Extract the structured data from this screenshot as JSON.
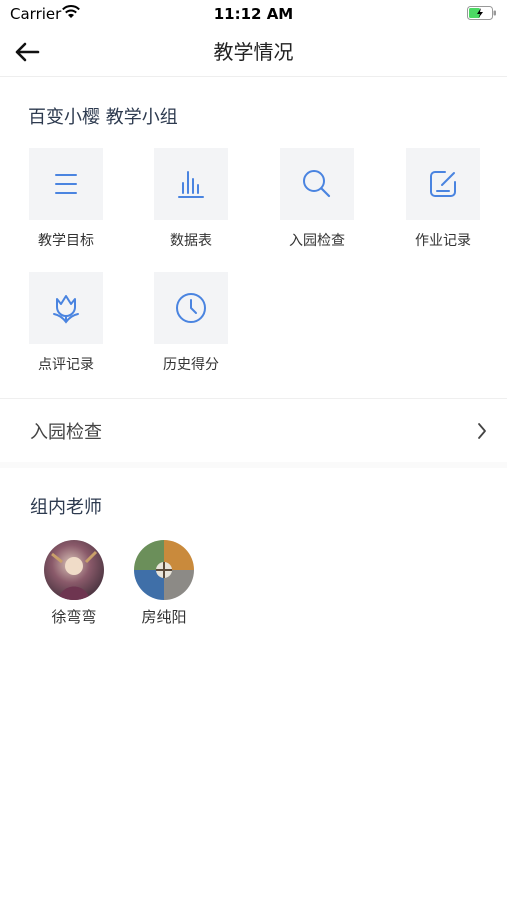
{
  "status_bar": {
    "carrier": "Carrier",
    "time": "11:12 AM"
  },
  "nav": {
    "title": "教学情况"
  },
  "group": {
    "title": "百变小樱 教学小组",
    "items": [
      {
        "label": "教学目标",
        "icon": "list-icon"
      },
      {
        "label": "数据表",
        "icon": "bar-chart-icon"
      },
      {
        "label": "入园检查",
        "icon": "search-icon"
      },
      {
        "label": "作业记录",
        "icon": "edit-icon"
      },
      {
        "label": "点评记录",
        "icon": "tulip-icon"
      },
      {
        "label": "历史得分",
        "icon": "clock-icon"
      }
    ]
  },
  "entry_row": {
    "label": "入园检查"
  },
  "teachers": {
    "title": "组内老师",
    "list": [
      {
        "name": "徐弯弯"
      },
      {
        "name": "房纯阳"
      }
    ]
  },
  "colors": {
    "accent": "#4a84e0",
    "tile_bg": "#f3f4f6",
    "heading": "#2d3a4f"
  }
}
